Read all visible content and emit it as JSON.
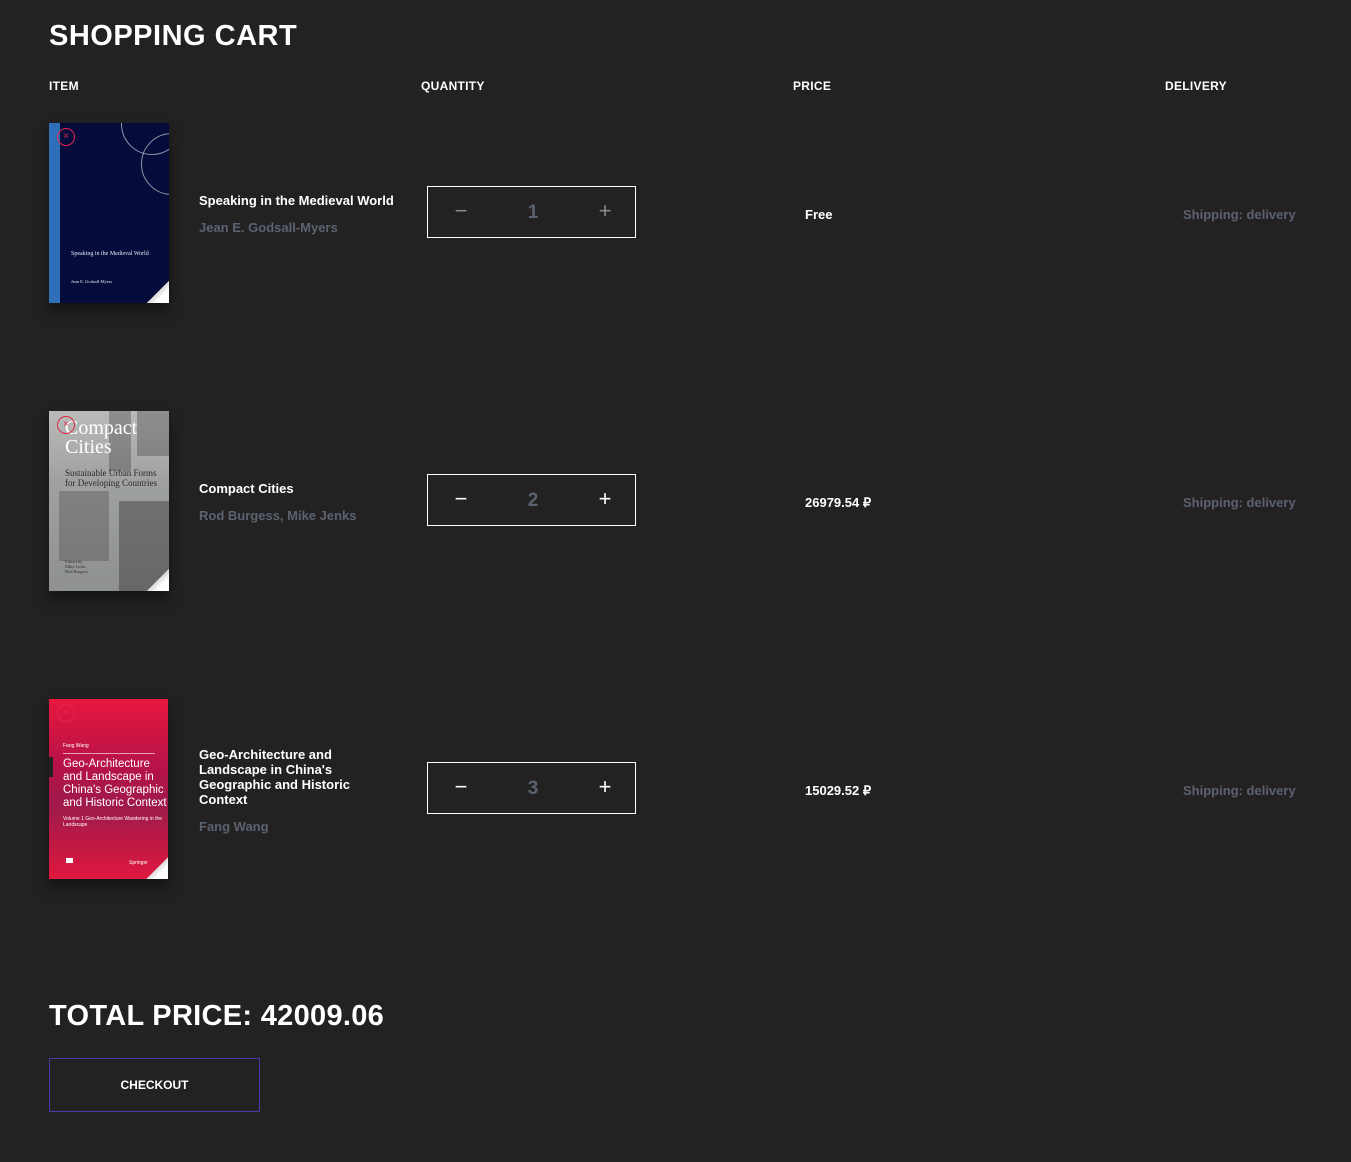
{
  "page": {
    "title": "SHOPPING CART",
    "columns": {
      "item": "ITEM",
      "quantity": "QUANTITY",
      "price": "PRICE",
      "delivery": "DELIVERY"
    }
  },
  "items": [
    {
      "title": "Speaking in the Medieval World",
      "author": "Jean E. Godsall-Myers",
      "quantity": "1",
      "price": "Free",
      "delivery": "Shipping: delivery",
      "cover": {
        "title": "Speaking in the Medieval World",
        "author": "Jean E. Godsall-Myers",
        "color": "#050c3c"
      }
    },
    {
      "title": "Compact Cities",
      "author": "Rod Burgess, Mike Jenks",
      "quantity": "2",
      "price": "26979.54 ₽",
      "delivery": "Shipping: delivery",
      "cover": {
        "title_line1": "Compact",
        "title_line2": "Cities",
        "subtitle_line1": "Sustainable Urban Forms",
        "subtitle_line2": "for Developing Countries",
        "editors_line1": "Edited by",
        "editors_line2": "Mike Jenks",
        "editors_line3": "Rod Burgess",
        "color": "#9ea19f"
      }
    },
    {
      "title": "Geo-Architecture and Landscape in China's Geographic and Historic Context",
      "author": "Fang Wang",
      "quantity": "3",
      "price": "15029.52 ₽",
      "delivery": "Shipping: delivery",
      "cover": {
        "author": "Fang Wang",
        "title": "Geo-Architecture and Landscape in China's Geographic and Historic Context",
        "subtitle": "Volume 1 Geo-Architecture Wandering in the Landscape",
        "publisher": "Springer",
        "color": "#e7173d"
      }
    }
  ],
  "controls": {
    "minus": "−",
    "plus": "+",
    "remove": "×"
  },
  "summary": {
    "total": "TOTAL PRICE: 42009.06",
    "checkout": "CHECKOUT"
  },
  "colors": {
    "background": "#232122",
    "muted": "#5b6270",
    "remove": "#e0284a",
    "checkout_border": "#4a3aa8"
  }
}
